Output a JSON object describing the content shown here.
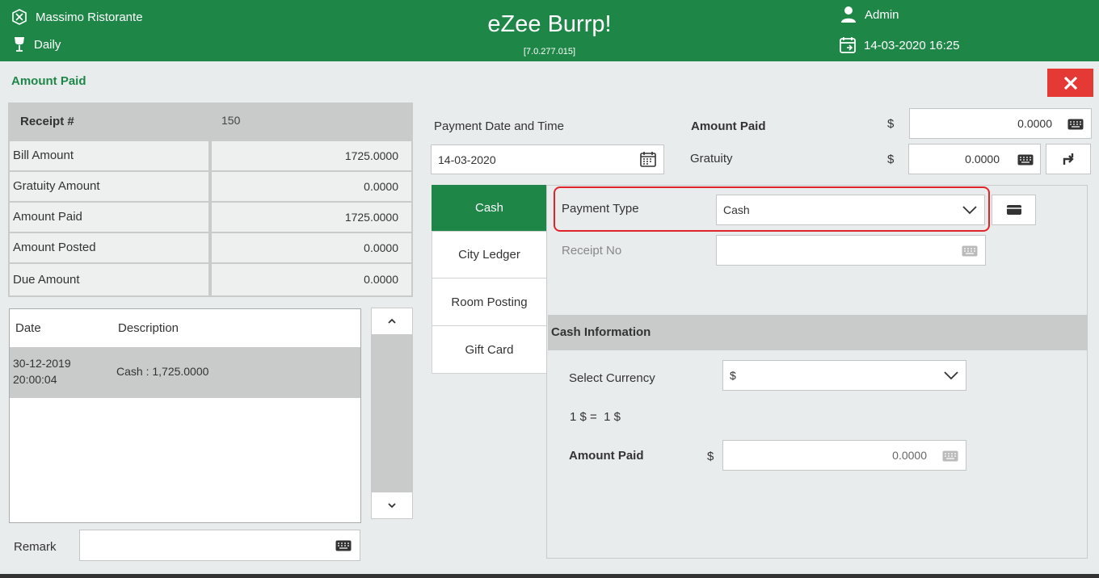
{
  "header": {
    "restaurant": "Massimo Ristorante",
    "period": "Daily",
    "app_title": "eZee Burrp!",
    "version": "[7.0.277.015]",
    "user": "Admin",
    "datetime": "14-03-2020 16:25"
  },
  "page": {
    "title": "Amount Paid"
  },
  "summary": {
    "receipt_label": "Receipt #",
    "receipt_value": "150",
    "rows": [
      {
        "label": "Bill Amount",
        "value": "1725.0000"
      },
      {
        "label": "Gratuity Amount",
        "value": "0.0000"
      },
      {
        "label": "Amount Paid",
        "value": "1725.0000"
      },
      {
        "label": "Amount Posted",
        "value": "0.0000"
      },
      {
        "label": "Due Amount",
        "value": "0.0000"
      }
    ]
  },
  "history": {
    "col_date": "Date",
    "col_desc": "Description",
    "rows": [
      {
        "date_line1": "30-12-2019",
        "date_line2": "20:00:04",
        "description": "Cash : 1,725.0000"
      }
    ]
  },
  "remark": {
    "label": "Remark",
    "value": ""
  },
  "payment": {
    "date_label": "Payment Date and Time",
    "date_value": "14-03-2020",
    "amount_paid_label": "Amount Paid",
    "amount_paid_currency": "$",
    "amount_paid_value": "0.0000",
    "gratuity_label": "Gratuity",
    "gratuity_currency": "$",
    "gratuity_value": "0.0000"
  },
  "tabs": [
    "Cash",
    "City Ledger",
    "Room Posting",
    "Gift Card"
  ],
  "cash": {
    "payment_type_label": "Payment Type",
    "payment_type_value": "Cash",
    "receipt_no_label": "Receipt No",
    "receipt_no_value": "",
    "section_title": "Cash Information",
    "currency_label": "Select Currency",
    "currency_value": "$",
    "rate_text": "1 $ =  1 $",
    "amount_paid_label": "Amount Paid",
    "amount_paid_currency": "$",
    "amount_paid_value": "0.0000"
  },
  "colors": {
    "brand": "#1e8748",
    "close": "#e53935",
    "highlight": "#e0242a"
  }
}
